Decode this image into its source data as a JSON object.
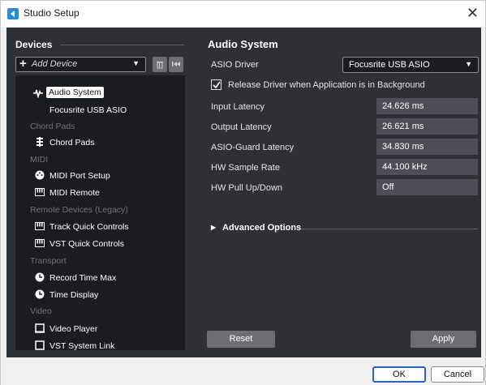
{
  "window": {
    "title": "Studio Setup",
    "close_glyph": "✕"
  },
  "devices": {
    "heading": "Devices",
    "add_device_label": "Add Device",
    "tree": [
      {
        "kind": "item",
        "label": "Audio System",
        "icon": "audio-system-icon",
        "selected": true
      },
      {
        "kind": "sub",
        "label": "Focusrite USB ASIO"
      },
      {
        "kind": "category",
        "label": "Chord Pads"
      },
      {
        "kind": "item",
        "label": "Chord Pads",
        "icon": "chord-pads-icon"
      },
      {
        "kind": "category",
        "label": "MIDI"
      },
      {
        "kind": "item",
        "label": "MIDI Port Setup",
        "icon": "midi-port-icon"
      },
      {
        "kind": "item",
        "label": "MIDI Remote",
        "icon": "keyboard-icon"
      },
      {
        "kind": "category",
        "label": "Remote Devices (Legacy)"
      },
      {
        "kind": "item",
        "label": "Track Quick Controls",
        "icon": "keyboard-icon"
      },
      {
        "kind": "item",
        "label": "VST Quick Controls",
        "icon": "keyboard-icon"
      },
      {
        "kind": "category",
        "label": "Transport"
      },
      {
        "kind": "item",
        "label": "Record Time Max",
        "icon": "clock-icon"
      },
      {
        "kind": "item",
        "label": "Time Display",
        "icon": "clock-icon"
      },
      {
        "kind": "category",
        "label": "Video"
      },
      {
        "kind": "item",
        "label": "Video Player",
        "icon": "video-icon"
      },
      {
        "kind": "item",
        "label": "VST System Link",
        "icon": "link-icon"
      }
    ]
  },
  "audio_system": {
    "heading": "Audio System",
    "asio_driver_label": "ASIO Driver",
    "asio_driver_value": "Focusrite USB ASIO",
    "release_driver_label": "Release Driver when Application is in Background",
    "release_driver_checked": true,
    "rows": [
      {
        "label": "Input Latency",
        "value": "24.626 ms"
      },
      {
        "label": "Output Latency",
        "value": "26.621 ms"
      },
      {
        "label": "ASIO-Guard Latency",
        "value": "34.830 ms"
      },
      {
        "label": "HW Sample Rate",
        "value": "44.100 kHz"
      },
      {
        "label": "HW Pull Up/Down",
        "value": "Off"
      }
    ],
    "advanced_label": "Advanced Options",
    "reset_label": "Reset",
    "apply_label": "Apply"
  },
  "footer": {
    "ok_label": "OK",
    "cancel_label": "Cancel"
  },
  "colors": {
    "panel_bg": "#2c3135",
    "field_bg": "#4a5055",
    "list_bg": "#1a1d1f"
  }
}
